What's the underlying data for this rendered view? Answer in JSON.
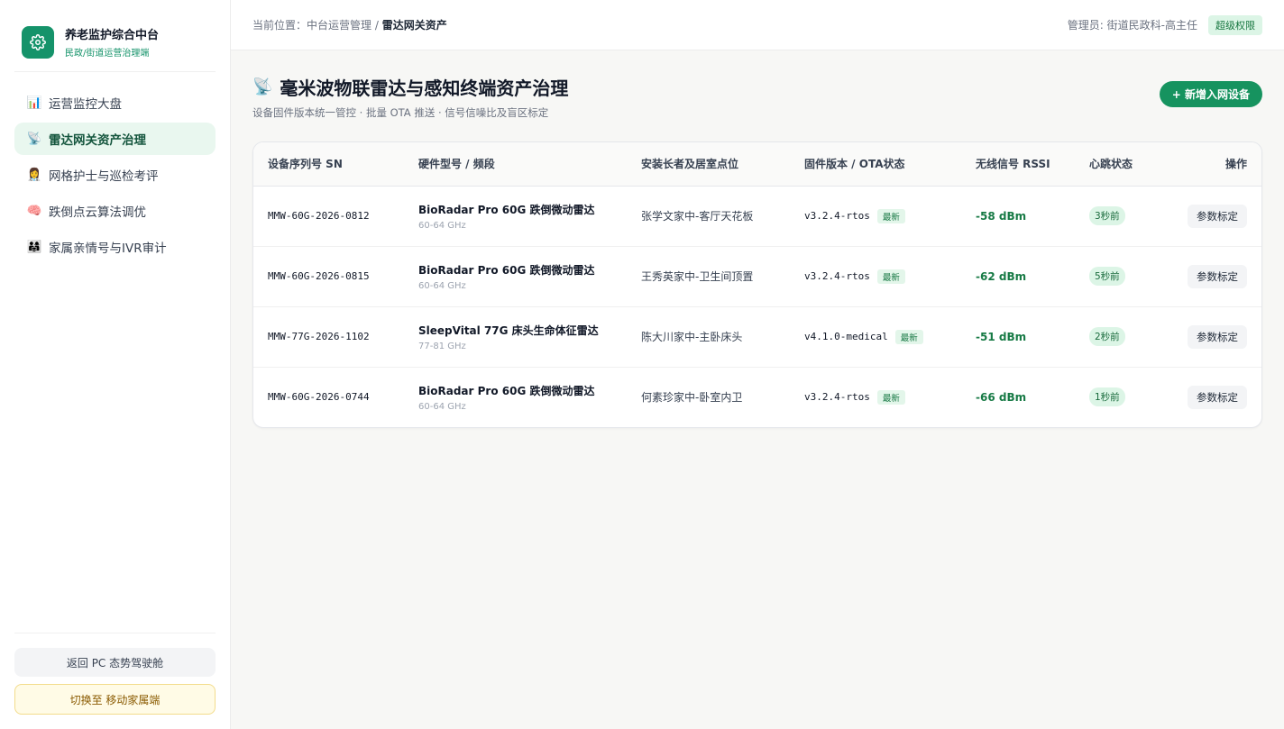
{
  "brand": {
    "title": "养老监护综合中台",
    "subtitle": "民政/街道运营治理端"
  },
  "nav": [
    {
      "label": "运营监控大盘",
      "icon": "bar-chart-icon",
      "emoji": "📊",
      "active": false
    },
    {
      "label": "雷达网关资产治理",
      "icon": "satellite-dish-icon",
      "emoji": "📡",
      "active": true
    },
    {
      "label": "网格护士与巡检考评",
      "icon": "nurse-icon",
      "emoji": "👩‍⚕️",
      "active": false
    },
    {
      "label": "跌倒点云算法调优",
      "icon": "brain-icon",
      "emoji": "🧠",
      "active": false
    },
    {
      "label": "家属亲情号与IVR审计",
      "icon": "family-icon",
      "emoji": "👨‍👩‍👧",
      "active": false
    }
  ],
  "footer": {
    "back_label": "返回 PC 态势驾驶舱",
    "switch_label": "切换至 移动家属端"
  },
  "topbar": {
    "breadcrumb_prefix": "当前位置：",
    "breadcrumb_parent": "中台运营管理",
    "breadcrumb_sep": " / ",
    "breadcrumb_current": "雷达网关资产",
    "admin_label": "管理员: 街道民政科-高主任",
    "role_badge": "超级权限"
  },
  "page": {
    "title": "毫米波物联雷达与感知终端资产治理",
    "subtitle": "设备固件版本统一管控 · 批量 OTA 推送 · 信号信噪比及盲区标定",
    "add_button": "+ 新增入网设备"
  },
  "table": {
    "headers": [
      "设备序列号 SN",
      "硬件型号 / 频段",
      "安装长者及居室点位",
      "固件版本 / OTA状态",
      "无线信号 RSSI",
      "心跳状态",
      "操作"
    ],
    "rows": [
      {
        "sn": "MMW-60G-2026-0812",
        "model": "BioRadar Pro 60G 跌倒微动雷达",
        "band": "60-64 GHz",
        "location": "张学文家中-客厅天花板",
        "firmware": "v3.2.4-rtos",
        "ota": "最新",
        "rssi": "-58 dBm",
        "heartbeat": "3秒前",
        "action": "参数标定"
      },
      {
        "sn": "MMW-60G-2026-0815",
        "model": "BioRadar Pro 60G 跌倒微动雷达",
        "band": "60-64 GHz",
        "location": "王秀英家中-卫生间顶置",
        "firmware": "v3.2.4-rtos",
        "ota": "最新",
        "rssi": "-62 dBm",
        "heartbeat": "5秒前",
        "action": "参数标定"
      },
      {
        "sn": "MMW-77G-2026-1102",
        "model": "SleepVital 77G 床头生命体征雷达",
        "band": "77-81 GHz",
        "location": "陈大川家中-主卧床头",
        "firmware": "v4.1.0-medical",
        "ota": "最新",
        "rssi": "-51 dBm",
        "heartbeat": "2秒前",
        "action": "参数标定"
      },
      {
        "sn": "MMW-60G-2026-0744",
        "model": "BioRadar Pro 60G 跌倒微动雷达",
        "band": "60-64 GHz",
        "location": "何素珍家中-卧室内卫",
        "firmware": "v3.2.4-rtos",
        "ota": "最新",
        "rssi": "-66 dBm",
        "heartbeat": "1秒前",
        "action": "参数标定"
      }
    ]
  },
  "colors": {
    "accent": "#15936a",
    "active_bg": "#e9f7ef",
    "badge_bg": "#dcf5e6"
  }
}
